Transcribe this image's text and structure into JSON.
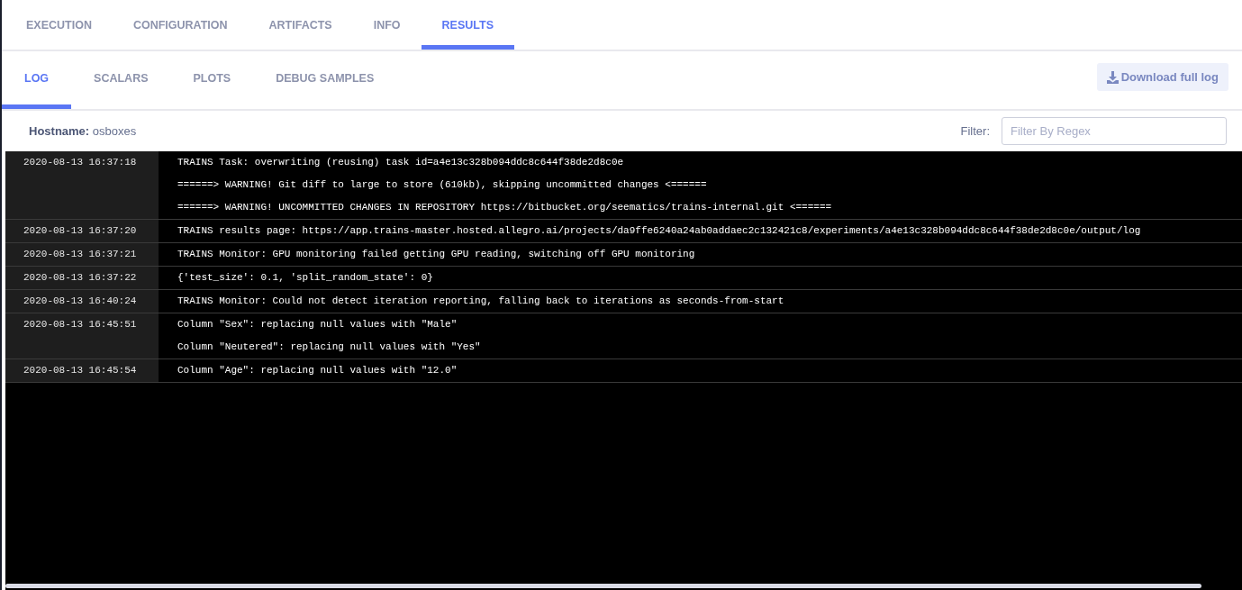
{
  "tabs": [
    {
      "label": "EXECUTION",
      "selected": false
    },
    {
      "label": "CONFIGURATION",
      "selected": false
    },
    {
      "label": "ARTIFACTS",
      "selected": false
    },
    {
      "label": "INFO",
      "selected": false
    },
    {
      "label": "RESULTS",
      "selected": true
    }
  ],
  "subtabs": [
    {
      "label": "LOG",
      "selected": true
    },
    {
      "label": "SCALARS",
      "selected": false
    },
    {
      "label": "PLOTS",
      "selected": false
    },
    {
      "label": "DEBUG SAMPLES",
      "selected": false
    }
  ],
  "download_button": "Download full log",
  "hostname": {
    "label": "Hostname:",
    "value": "osboxes"
  },
  "filter": {
    "label": "Filter:",
    "placeholder": "Filter By Regex"
  },
  "log": [
    {
      "time": "2020-08-13 16:37:18",
      "lines": [
        "TRAINS Task: overwriting (reusing) task id=a4e13c328b094ddc8c644f38de2d8c0e",
        "======> WARNING! Git diff to large to store (610kb), skipping uncommitted changes <======",
        "======> WARNING! UNCOMMITTED CHANGES IN REPOSITORY https://bitbucket.org/seematics/trains-internal.git <======"
      ]
    },
    {
      "time": "2020-08-13 16:37:20",
      "lines": [
        "TRAINS results page: https://app.trains-master.hosted.allegro.ai/projects/da9ffe6240a24ab0addaec2c132421c8/experiments/a4e13c328b094ddc8c644f38de2d8c0e/output/log"
      ]
    },
    {
      "time": "2020-08-13 16:37:21",
      "lines": [
        "TRAINS Monitor: GPU monitoring failed getting GPU reading, switching off GPU monitoring"
      ]
    },
    {
      "time": "2020-08-13 16:37:22",
      "lines": [
        "{'test_size': 0.1, 'split_random_state': 0}"
      ]
    },
    {
      "time": "2020-08-13 16:40:24",
      "lines": [
        "TRAINS Monitor: Could not detect iteration reporting, falling back to iterations as seconds-from-start"
      ]
    },
    {
      "time": "2020-08-13 16:45:51",
      "lines": [
        "Column \"Sex\": replacing null values with \"Male\"",
        "Column \"Neutered\": replacing null values with \"Yes\""
      ]
    },
    {
      "time": "2020-08-13 16:45:54",
      "lines": [
        "Column \"Age\": replacing null values with \"12.0\""
      ]
    }
  ]
}
